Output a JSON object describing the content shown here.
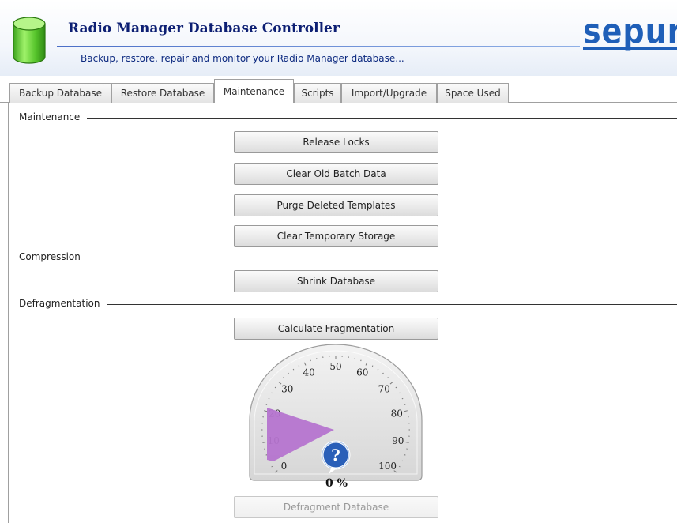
{
  "header": {
    "title": "Radio Manager Database Controller",
    "subtitle": "Backup, restore, repair and monitor your Radio Manager database...",
    "brand": "sepura",
    "icon": "database-icon"
  },
  "tabs": [
    {
      "label": "Backup Database",
      "active": false
    },
    {
      "label": "Restore Database",
      "active": false
    },
    {
      "label": "Maintenance",
      "active": true
    },
    {
      "label": "Scripts",
      "active": false
    },
    {
      "label": "Import/Upgrade",
      "active": false
    },
    {
      "label": "Space Used",
      "active": false
    }
  ],
  "maintenance": {
    "label": "Maintenance",
    "buttons": [
      "Release Locks",
      "Clear Old Batch Data",
      "Purge Deleted Templates",
      "Clear Temporary Storage"
    ]
  },
  "compression": {
    "label": "Compression",
    "buttons": [
      "Shrink Database"
    ]
  },
  "defragmentation": {
    "label": "Defragmentation",
    "calculate_button": "Calculate Fragmentation",
    "defragment_button": "Defragment Database",
    "defragment_enabled": false,
    "gauge": {
      "value": 0,
      "percent_text": "0 %",
      "tick_labels": [
        "0",
        "10",
        "20",
        "30",
        "40",
        "50",
        "60",
        "70",
        "80",
        "90",
        "100"
      ],
      "indicator_color": "#b574cf",
      "help_icon": "question-icon"
    }
  }
}
